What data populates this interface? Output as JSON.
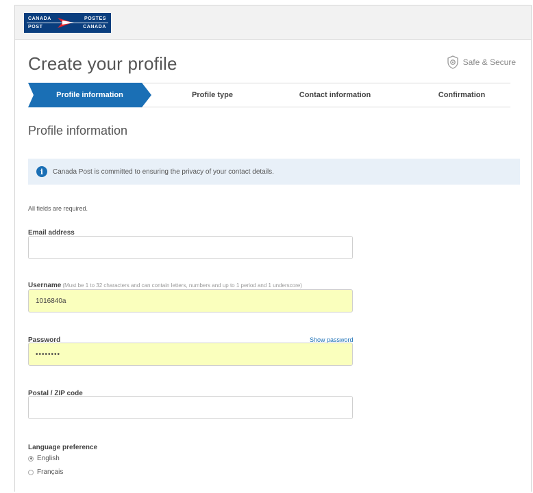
{
  "logo": {
    "top_left": "CANADA",
    "bottom_left": "POST",
    "top_right": "POSTES",
    "bottom_right": "CANADA",
    "colors": {
      "background": "#0a3e7e",
      "accent": "#e4232b"
    }
  },
  "page": {
    "title": "Create your profile",
    "secure_label": "Safe & Secure",
    "secure_icon": "shield-icon"
  },
  "steps": [
    {
      "label": "Profile information",
      "active": true
    },
    {
      "label": "Profile type",
      "active": false
    },
    {
      "label": "Contact information",
      "active": false
    },
    {
      "label": "Confirmation",
      "active": false
    }
  ],
  "section": {
    "title": "Profile information",
    "notice": "Canada Post is committed to ensuring the privacy of your contact details.",
    "notice_icon": "info-icon",
    "required_note": "All fields are required."
  },
  "form": {
    "email": {
      "label": "Email address",
      "value": ""
    },
    "username": {
      "label": "Username",
      "hint": "(Must be 1 to 32 characters and can contain letters, numbers and up to 1 period and 1 underscore)",
      "value": "1016840a"
    },
    "password": {
      "label": "Password",
      "value": "••••••••",
      "show_label": "Show password"
    },
    "postal": {
      "label": "Postal / ZIP code",
      "value": ""
    },
    "language": {
      "label": "Language preference",
      "options": [
        {
          "label": "English",
          "selected": true
        },
        {
          "label": "Français",
          "selected": false
        }
      ]
    }
  },
  "colors": {
    "primary": "#1a6fb5",
    "autofill": "#faffbd",
    "notice_bg": "#e8f0f8"
  }
}
